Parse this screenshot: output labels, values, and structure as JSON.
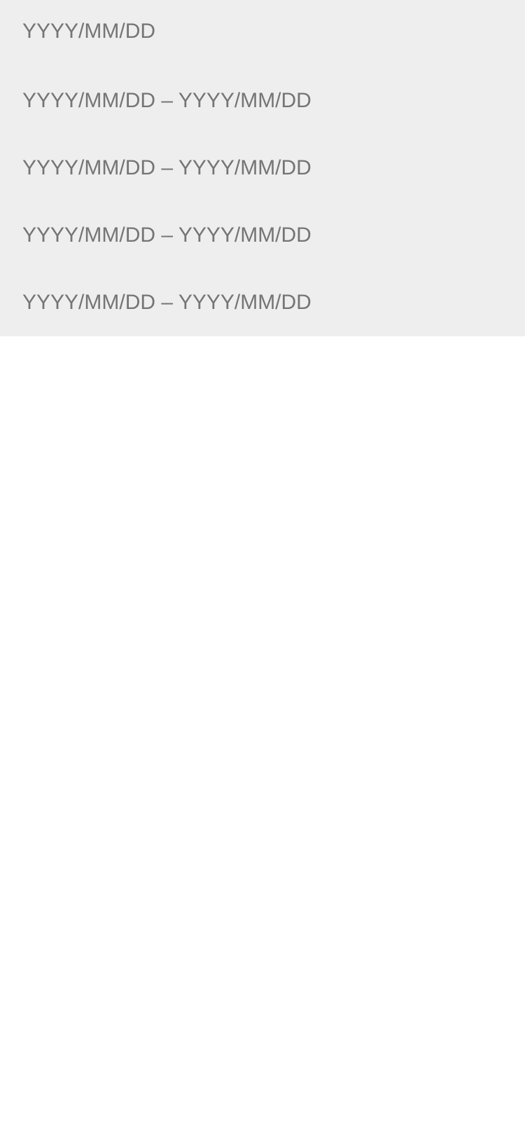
{
  "date_list": {
    "items": [
      {
        "label": "YYYY/MM/DD"
      },
      {
        "label": "YYYY/MM/DD – YYYY/MM/DD"
      },
      {
        "label": "YYYY/MM/DD – YYYY/MM/DD"
      },
      {
        "label": "YYYY/MM/DD – YYYY/MM/DD"
      },
      {
        "label": "YYYY/MM/DD – YYYY/MM/DD"
      }
    ]
  },
  "colors": {
    "list_background": "#eeeeee",
    "text": "#757575",
    "page_background": "#ffffff"
  }
}
